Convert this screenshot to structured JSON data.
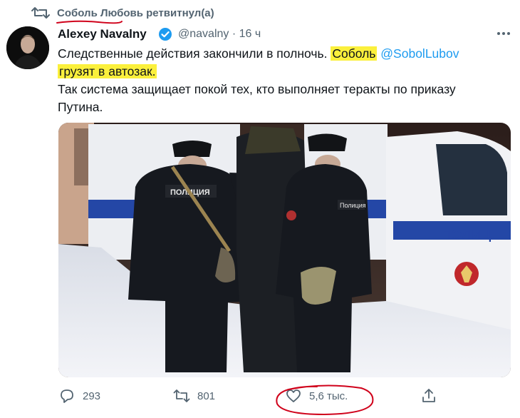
{
  "retweet_line": {
    "text": "Соболь Любовь ретвитнул(а)"
  },
  "tweet": {
    "author_name": "Alexey Navalny",
    "handle": "@navalny",
    "separator": "·",
    "time": "16 ч",
    "text": {
      "line1_prefix": "Следственные действия закончили в полночь.",
      "line1_highlight": "Соболь",
      "mention": "@SobolLubov",
      "line2_highlight": "грузят в автозак.",
      "line3": "Так система защищает покой тех, кто выполняет теракты по приказу",
      "line4": "Путина."
    },
    "photo": {
      "jacket_patch": "ПОЛИЦИЯ",
      "shoulder_patch": "Полиция",
      "van_text": "ПОЛИЦ"
    }
  },
  "actions": {
    "replies": "293",
    "retweets": "801",
    "likes": "5,6 тыс."
  },
  "colors": {
    "highlight": "#fbf03c",
    "accent": "#1d9bf0",
    "annotation": "#d0021b"
  }
}
